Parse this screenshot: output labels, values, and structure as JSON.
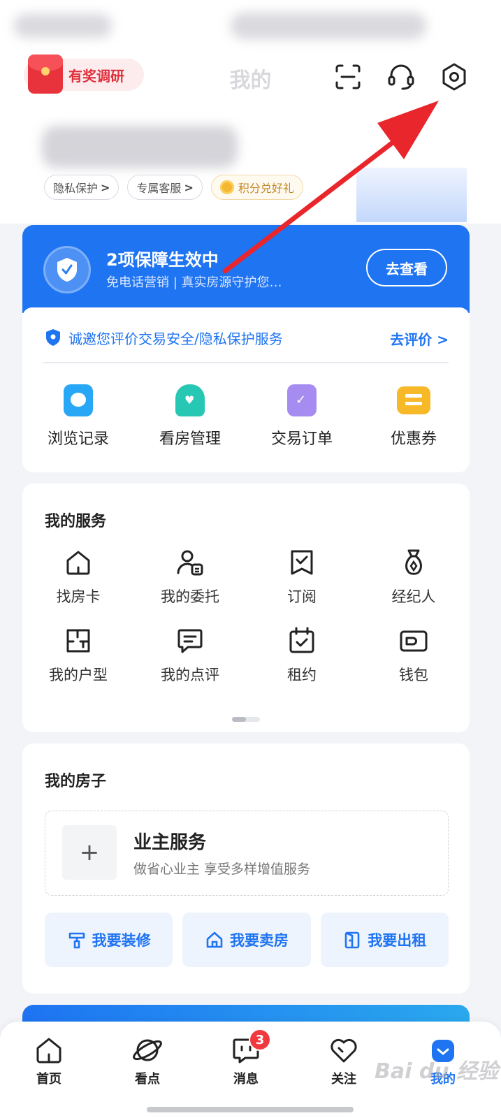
{
  "header": {
    "survey_badge": "有奖调研",
    "title": "我的"
  },
  "profile": {
    "pills": [
      {
        "label": "隐私保护",
        "chevron": ">"
      },
      {
        "label": "专属客服",
        "chevron": ">"
      },
      {
        "label": "积分兑好礼"
      }
    ]
  },
  "guarantee": {
    "title": "2项保障生效中",
    "subtitle": "免电话营销 | 真实房源守护您…",
    "button": "去查看",
    "invite_text": "诚邀您评价交易安全/隐私保护服务",
    "invite_link": "去评价 >",
    "quick": [
      {
        "label": "浏览记录",
        "icon": "chat-bubble-icon",
        "color": "#27a7f5"
      },
      {
        "label": "看房管理",
        "icon": "house-heart-icon",
        "color": "#26c7b3"
      },
      {
        "label": "交易订单",
        "icon": "clipboard-check-icon",
        "color": "#a68cf0"
      },
      {
        "label": "优惠券",
        "icon": "ticket-icon",
        "color": "#f7b928"
      }
    ]
  },
  "services": {
    "title": "我的服务",
    "items": [
      {
        "label": "找房卡",
        "icon": "house-card-icon"
      },
      {
        "label": "我的委托",
        "icon": "person-document-icon"
      },
      {
        "label": "订阅",
        "icon": "bookmark-check-icon"
      },
      {
        "label": "经纪人",
        "icon": "agent-bag-icon"
      },
      {
        "label": "我的户型",
        "icon": "floorplan-icon"
      },
      {
        "label": "我的点评",
        "icon": "comment-icon"
      },
      {
        "label": "租约",
        "icon": "calendar-check-icon"
      },
      {
        "label": "钱包",
        "icon": "wallet-icon"
      }
    ]
  },
  "my_house": {
    "title": "我的房子",
    "plus": "+",
    "owner_title": "业主服务",
    "owner_subtitle": "做省心业主 享受多样增值服务",
    "actions": [
      {
        "label": "我要装修",
        "icon": "paint-roller-icon"
      },
      {
        "label": "我要卖房",
        "icon": "house-icon"
      },
      {
        "label": "我要出租",
        "icon": "door-icon"
      }
    ]
  },
  "tabbar": {
    "tabs": [
      {
        "label": "首页",
        "icon": "home-icon"
      },
      {
        "label": "看点",
        "icon": "planet-icon"
      },
      {
        "label": "消息",
        "icon": "message-icon",
        "badge": "3"
      },
      {
        "label": "关注",
        "icon": "heart-icon"
      },
      {
        "label": "我的",
        "icon": "profile-icon",
        "active": true
      }
    ]
  },
  "watermark": "Bai du 经验",
  "colors": {
    "accent": "#1f74f2",
    "badge_red": "#f0393e",
    "survey_red": "#e02f3b",
    "annotation_arrow": "#e8262b"
  }
}
